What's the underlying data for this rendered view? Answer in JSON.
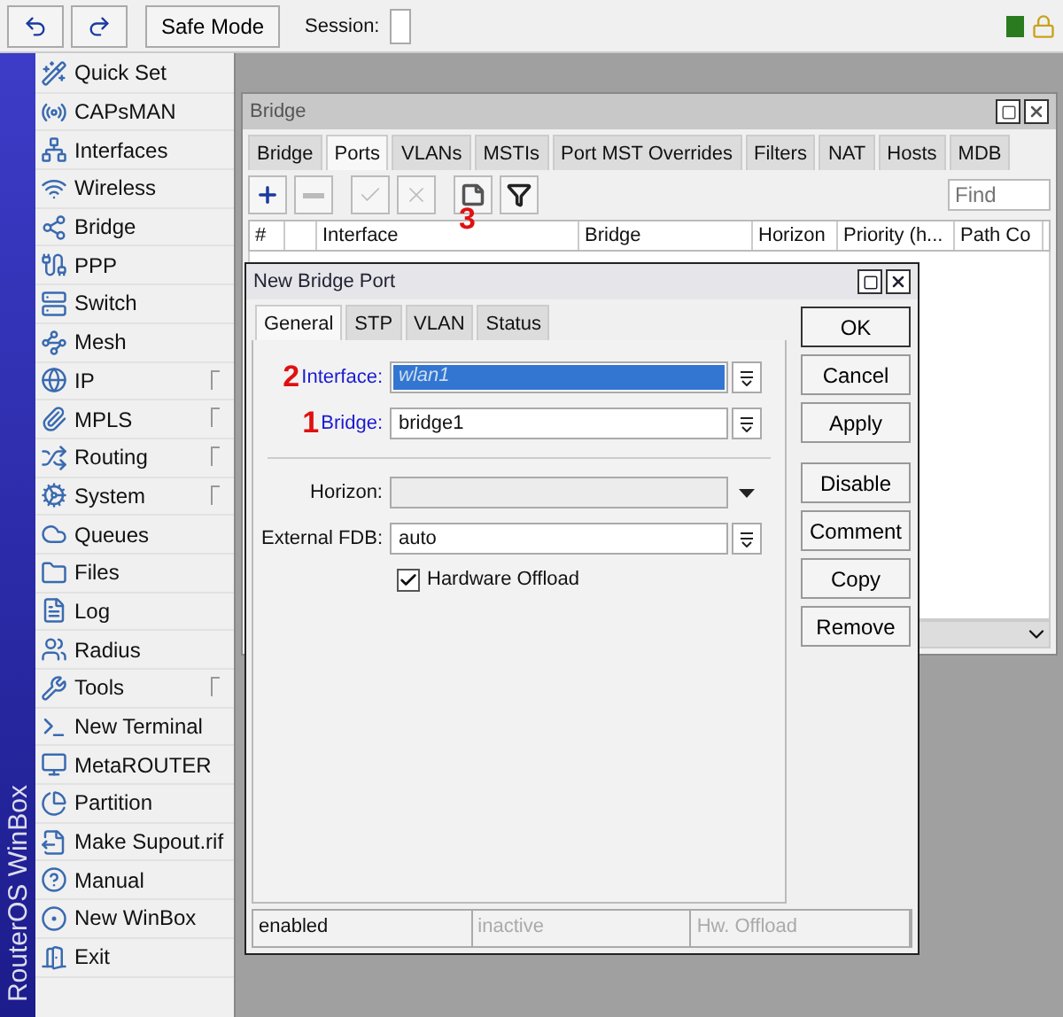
{
  "toolbar": {
    "safe_mode": "Safe Mode",
    "session_label": "Session:"
  },
  "side_banner": "RouterOS WinBox",
  "menu": [
    {
      "label": "Quick Set",
      "has_submenu": false
    },
    {
      "label": "CAPsMAN",
      "has_submenu": false
    },
    {
      "label": "Interfaces",
      "has_submenu": false
    },
    {
      "label": "Wireless",
      "has_submenu": false
    },
    {
      "label": "Bridge",
      "has_submenu": false
    },
    {
      "label": "PPP",
      "has_submenu": false
    },
    {
      "label": "Switch",
      "has_submenu": false
    },
    {
      "label": "Mesh",
      "has_submenu": false
    },
    {
      "label": "IP",
      "has_submenu": true
    },
    {
      "label": "MPLS",
      "has_submenu": true
    },
    {
      "label": "Routing",
      "has_submenu": true
    },
    {
      "label": "System",
      "has_submenu": true
    },
    {
      "label": "Queues",
      "has_submenu": false
    },
    {
      "label": "Files",
      "has_submenu": false
    },
    {
      "label": "Log",
      "has_submenu": false
    },
    {
      "label": "Radius",
      "has_submenu": false
    },
    {
      "label": "Tools",
      "has_submenu": true
    },
    {
      "label": "New Terminal",
      "has_submenu": false
    },
    {
      "label": "MetaROUTER",
      "has_submenu": false
    },
    {
      "label": "Partition",
      "has_submenu": false
    },
    {
      "label": "Make Supout.rif",
      "has_submenu": false
    },
    {
      "label": "Manual",
      "has_submenu": false
    },
    {
      "label": "New WinBox",
      "has_submenu": false
    },
    {
      "label": "Exit",
      "has_submenu": false
    }
  ],
  "bridge_window": {
    "title": "Bridge",
    "tabs": [
      {
        "label": "Bridge",
        "selected": false
      },
      {
        "label": "Ports",
        "selected": true
      },
      {
        "label": "VLANs",
        "selected": false
      },
      {
        "label": "MSTIs",
        "selected": false
      },
      {
        "label": "Port MST Overrides",
        "selected": false
      },
      {
        "label": "Filters",
        "selected": false
      },
      {
        "label": "NAT",
        "selected": false
      },
      {
        "label": "Hosts",
        "selected": false
      },
      {
        "label": "MDB",
        "selected": false
      }
    ],
    "tools": [
      {
        "kind": "add",
        "disabled": false
      },
      {
        "kind": "remove",
        "disabled": true
      },
      {
        "kind": "enable",
        "disabled": true
      },
      {
        "kind": "disable",
        "disabled": true
      },
      {
        "kind": "comment",
        "disabled": false
      },
      {
        "kind": "filter",
        "disabled": false
      }
    ],
    "annotation": "3",
    "find_placeholder": "Find",
    "columns": [
      "#",
      "",
      "Interface",
      "Bridge",
      "Horizon",
      "Priority (h...",
      "Path Co"
    ]
  },
  "dialog": {
    "title": "New Bridge Port",
    "tabs": [
      {
        "label": "General",
        "selected": true
      },
      {
        "label": "STP",
        "selected": false
      },
      {
        "label": "VLAN",
        "selected": false
      },
      {
        "label": "Status",
        "selected": false
      }
    ],
    "groups": [
      [
        {
          "kind": "combo",
          "label": "Interface:",
          "value": "wlan1",
          "marker": "2",
          "link": true,
          "highlighted": true,
          "disabled": false
        },
        {
          "kind": "combo",
          "label": "Bridge:",
          "value": "bridge1",
          "marker": "1",
          "link": true,
          "highlighted": false,
          "disabled": false
        }
      ],
      [
        {
          "kind": "select",
          "label": "Horizon:",
          "link": false,
          "disabled": true
        },
        {
          "kind": "combo",
          "label": "External FDB:",
          "value": "auto",
          "link": false,
          "highlighted": false,
          "disabled": false
        }
      ]
    ],
    "checkbox": {
      "label": "Hardware Offload",
      "checked": true
    },
    "buttons": [
      {
        "label": "OK",
        "default": true
      },
      {
        "label": "Cancel",
        "default": false
      },
      {
        "label": "Apply",
        "default": false
      },
      {
        "label": "Disable",
        "default": false
      },
      {
        "label": "Comment",
        "default": false
      },
      {
        "label": "Copy",
        "default": false
      },
      {
        "label": "Remove",
        "default": false
      }
    ],
    "status": [
      {
        "text": "enabled",
        "dim": false
      },
      {
        "text": "inactive",
        "dim": true
      },
      {
        "text": "Hw. Offload",
        "dim": true
      }
    ]
  }
}
